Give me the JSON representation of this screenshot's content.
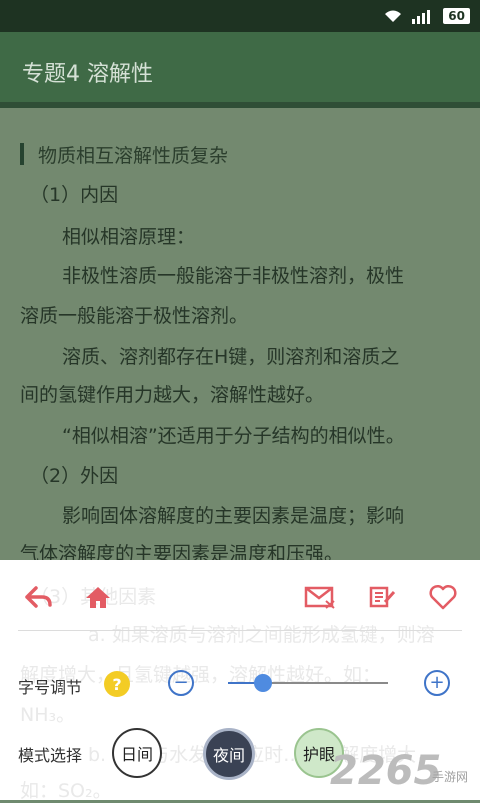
{
  "status": {
    "battery": "60"
  },
  "title": "专题4  溶解性",
  "content": {
    "heading": "物质相互溶解性质复杂",
    "lines": [
      "（1）内因",
      "相似相溶原理：",
      "非极性溶质一般能溶于非极性溶剂，极性",
      "溶质一般能溶于极性溶剂。",
      "溶质、溶剂都存在H键，则溶剂和溶质之",
      "间的氢键作用力越大，溶解性越好。",
      "“相似相溶”还适用于分子结构的相似性。",
      "（2）外因",
      "影响固体溶解度的主要因素是温度；影响",
      "气体溶解度的主要因素是温度和压强。"
    ],
    "ghost": [
      "（3）其他因素",
      "a. 如果溶质与溶剂之间能形成氢键，则溶",
      "解度增大，且氢键越强，溶解性越好。如：",
      "NH₃。",
      "b. 溶质与水发生反应时……溶解度增大，",
      "如：SO₂。"
    ]
  },
  "settings": {
    "font_size_label": "字号调节",
    "help_label": "?",
    "minus": "−",
    "plus": "+",
    "font_level": 0.22,
    "mode_label": "模式选择",
    "mode_day": "日间",
    "mode_night": "夜间",
    "mode_eye": "护眼"
  },
  "icons": [
    "back-icon",
    "home-icon",
    "mail-icon",
    "note-icon",
    "heart-icon"
  ],
  "colors": {
    "accent": "#e35c64",
    "slider": "#3f74c8",
    "toolbar": "#3f6a46"
  },
  "watermark": {
    "main": "2265",
    "sub": "手游网"
  }
}
